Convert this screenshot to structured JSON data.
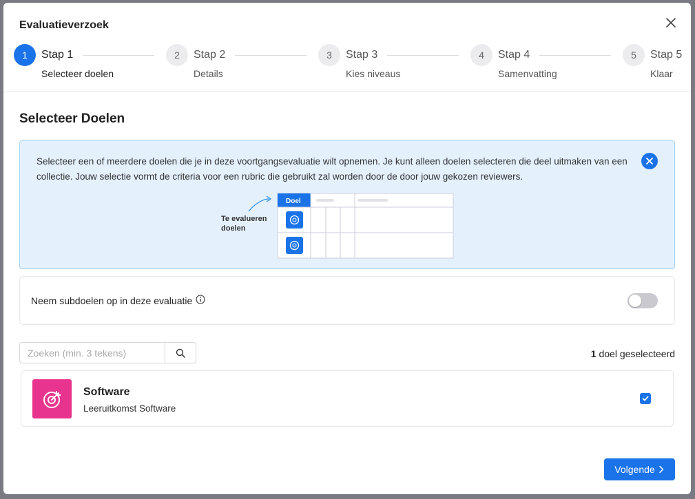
{
  "modal": {
    "title": "Evaluatieverzoek"
  },
  "steps": [
    {
      "number": "1",
      "label": "Stap 1",
      "sub": "Selecteer doelen",
      "active": true
    },
    {
      "number": "2",
      "label": "Stap 2",
      "sub": "Details",
      "active": false
    },
    {
      "number": "3",
      "label": "Stap 3",
      "sub": "Kies niveaus",
      "active": false
    },
    {
      "number": "4",
      "label": "Stap 4",
      "sub": "Samenvatting",
      "active": false
    },
    {
      "number": "5",
      "label": "Stap 5",
      "sub": "Klaar",
      "active": false
    }
  ],
  "section": {
    "title": "Selecteer Doelen"
  },
  "info": {
    "text": "Selecteer een of meerdere doelen die je in deze voortgangsevaluatie wilt opnemen. Je kunt alleen doelen selecteren die deel uitmaken van een collectie. Jouw selectie vormt de criteria voor een rubric die gebruikt zal worden door de door jouw gekozen reviewers.",
    "illustration": {
      "caption_line1": "Te evalueren",
      "caption_line2": "doelen",
      "header_label": "Doel"
    }
  },
  "subgoals_toggle": {
    "label": "Neem subdoelen op in deze evaluatie",
    "enabled": false
  },
  "search": {
    "placeholder": "Zoeken (min. 3 tekens)",
    "value": ""
  },
  "selection": {
    "count": "1",
    "suffix": " doel geselecteerd"
  },
  "goals": [
    {
      "title": "Software",
      "subtitle": "Leeruitkomst Software",
      "checked": true,
      "icon": "target-icon",
      "icon_color": "#e8348f"
    }
  ],
  "footer": {
    "next_label": "Volgende"
  },
  "colors": {
    "accent": "#1a73e8",
    "info_bg": "#e4f1fd",
    "goal_icon": "#e8348f"
  }
}
